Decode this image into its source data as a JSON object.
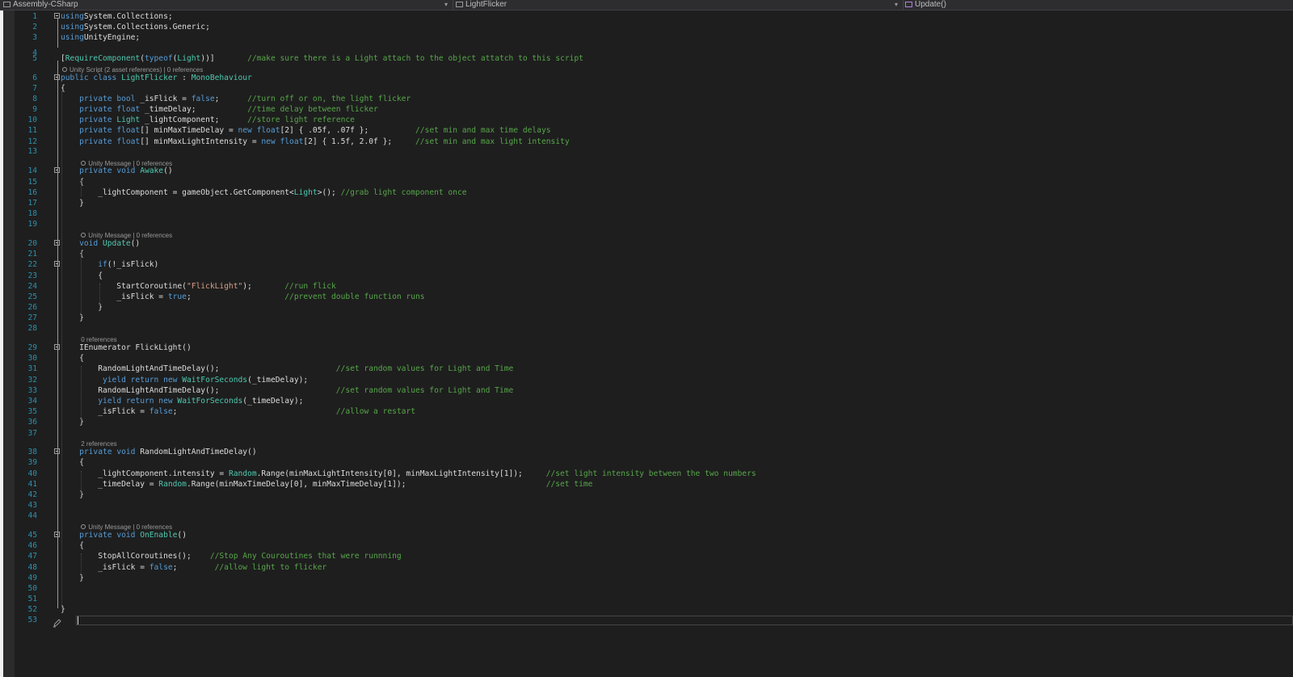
{
  "navbar": {
    "project": "Assembly-CSharp",
    "class": "LightFlicker",
    "member": "Update()"
  },
  "lenses": [
    {
      "line": 5,
      "indent": 0,
      "gear": true,
      "text": "Unity Script (2 asset references) | 0 references"
    },
    {
      "line": 13,
      "indent": 1,
      "gear": true,
      "text": "Unity Message | 0 references"
    },
    {
      "line": 19,
      "indent": 1,
      "gear": true,
      "text": "Unity Message | 0 references"
    },
    {
      "line": 28,
      "indent": 1,
      "gear": false,
      "text": "0 references"
    },
    {
      "line": 37,
      "indent": 1,
      "gear": false,
      "text": "2 references"
    },
    {
      "line": 44,
      "indent": 1,
      "gear": true,
      "text": "Unity Message | 0 references"
    }
  ],
  "lines": [
    {
      "n": 1,
      "fold": true,
      "tokens": [
        [
          "kw",
          "using"
        ],
        [
          "",
          "System.Collections;"
        ]
      ]
    },
    {
      "n": 2,
      "tokens": [
        [
          "kw",
          "using"
        ],
        [
          "",
          "System.Collections.Generic;"
        ]
      ]
    },
    {
      "n": 3,
      "tokens": [
        [
          "kw",
          "using"
        ],
        [
          "",
          "UnityEngine;"
        ]
      ]
    },
    {
      "n": 4,
      "tokens": []
    },
    {
      "n": 5,
      "tokens": [
        [
          "",
          "["
        ],
        [
          "ty",
          "RequireComponent"
        ],
        [
          "",
          "("
        ],
        [
          "kw",
          "typeof"
        ],
        [
          "",
          "("
        ],
        [
          "ty",
          "Light"
        ],
        [
          "",
          "))]       "
        ],
        [
          "cm",
          "//make sure there is a Light attach to the object attatch to this script"
        ]
      ]
    },
    {
      "n": 6,
      "fold": true,
      "tokens": [
        [
          "kw",
          "public class "
        ],
        [
          "ty",
          "LightFlicker"
        ],
        [
          "",
          " : "
        ],
        [
          "ty",
          "MonoBehaviour"
        ]
      ]
    },
    {
      "n": 7,
      "tokens": [
        [
          "",
          "{"
        ]
      ]
    },
    {
      "n": 8,
      "tokens": [
        [
          "",
          "    "
        ],
        [
          "kw",
          "private bool"
        ],
        [
          "",
          " _isFlick = "
        ],
        [
          "kw",
          "false"
        ],
        [
          "",
          ";      "
        ],
        [
          "cm",
          "//turn off or on, the light flicker"
        ]
      ]
    },
    {
      "n": 9,
      "tokens": [
        [
          "",
          "    "
        ],
        [
          "kw",
          "private float"
        ],
        [
          "",
          " _timeDelay;           "
        ],
        [
          "cm",
          "//time delay between flicker"
        ]
      ]
    },
    {
      "n": 10,
      "tokens": [
        [
          "",
          "    "
        ],
        [
          "kw",
          "private"
        ],
        [
          "",
          " "
        ],
        [
          "ty",
          "Light"
        ],
        [
          "",
          " _lightComponent;      "
        ],
        [
          "cm",
          "//store light reference"
        ]
      ]
    },
    {
      "n": 11,
      "tokens": [
        [
          "",
          "    "
        ],
        [
          "kw",
          "private float"
        ],
        [
          "",
          "[] minMaxTimeDelay = "
        ],
        [
          "kw",
          "new float"
        ],
        [
          "",
          "[2] { .05f, .07f };          "
        ],
        [
          "cm",
          "//set min and max time delays"
        ]
      ]
    },
    {
      "n": 12,
      "tokens": [
        [
          "",
          "    "
        ],
        [
          "kw",
          "private float"
        ],
        [
          "",
          "[] minMaxLightIntensity = "
        ],
        [
          "kw",
          "new float"
        ],
        [
          "",
          "[2] { 1.5f, 2.0f };     "
        ],
        [
          "cm",
          "//set min and max light intensity"
        ]
      ]
    },
    {
      "n": 13,
      "tokens": []
    },
    {
      "n": 14,
      "fold": true,
      "tokens": [
        [
          "",
          "    "
        ],
        [
          "kw",
          "private void"
        ],
        [
          "",
          " "
        ],
        [
          "ty",
          "Awake"
        ],
        [
          "",
          "()"
        ]
      ]
    },
    {
      "n": 15,
      "tokens": [
        [
          "",
          "    {"
        ]
      ]
    },
    {
      "n": 16,
      "tokens": [
        [
          "",
          "        _lightComponent = gameObject.GetComponent<"
        ],
        [
          "ty",
          "Light"
        ],
        [
          "",
          ">(); "
        ],
        [
          "cm",
          "//grab light component once"
        ]
      ]
    },
    {
      "n": 17,
      "tokens": [
        [
          "",
          "    }"
        ]
      ]
    },
    {
      "n": 18,
      "tokens": []
    },
    {
      "n": 19,
      "tokens": []
    },
    {
      "n": 20,
      "fold": true,
      "tokens": [
        [
          "",
          "    "
        ],
        [
          "kw",
          "void"
        ],
        [
          "",
          " "
        ],
        [
          "ty",
          "Update"
        ],
        [
          "",
          "()"
        ]
      ]
    },
    {
      "n": 21,
      "tokens": [
        [
          "",
          "    {"
        ]
      ]
    },
    {
      "n": 22,
      "fold": true,
      "tokens": [
        [
          "",
          "        "
        ],
        [
          "kw",
          "if"
        ],
        [
          "",
          "(!_isFlick)"
        ]
      ]
    },
    {
      "n": 23,
      "tokens": [
        [
          "",
          "        {"
        ]
      ]
    },
    {
      "n": 24,
      "tokens": [
        [
          "",
          "            StartCoroutine("
        ],
        [
          "str",
          "\"FlickLight\""
        ],
        [
          "",
          ");       "
        ],
        [
          "cm",
          "//run flick"
        ]
      ]
    },
    {
      "n": 25,
      "tokens": [
        [
          "",
          "            _isFlick = "
        ],
        [
          "kw",
          "true"
        ],
        [
          "",
          ";                    "
        ],
        [
          "cm",
          "//prevent double function runs"
        ]
      ]
    },
    {
      "n": 26,
      "tokens": [
        [
          "",
          "        }"
        ]
      ]
    },
    {
      "n": 27,
      "tokens": [
        [
          "",
          "    }"
        ]
      ]
    },
    {
      "n": 28,
      "tokens": []
    },
    {
      "n": 29,
      "fold": true,
      "tokens": [
        [
          "",
          "    IEnumerator FlickLight()"
        ]
      ]
    },
    {
      "n": 30,
      "tokens": [
        [
          "",
          "    {"
        ]
      ]
    },
    {
      "n": 31,
      "tokens": [
        [
          "",
          "        RandomLightAndTimeDelay();                         "
        ],
        [
          "cm",
          "//set random values for Light and Time"
        ]
      ]
    },
    {
      "n": 32,
      "tokens": [
        [
          "",
          "         "
        ],
        [
          "kw",
          "yield return new"
        ],
        [
          "",
          " "
        ],
        [
          "ty",
          "WaitForSeconds"
        ],
        [
          "",
          "(_timeDelay);"
        ]
      ]
    },
    {
      "n": 33,
      "tokens": [
        [
          "",
          "        RandomLightAndTimeDelay();                         "
        ],
        [
          "cm",
          "//set random values for Light and Time"
        ]
      ]
    },
    {
      "n": 34,
      "tokens": [
        [
          "",
          "        "
        ],
        [
          "kw",
          "yield return new"
        ],
        [
          "",
          " "
        ],
        [
          "ty",
          "WaitForSeconds"
        ],
        [
          "",
          "(_timeDelay);"
        ]
      ]
    },
    {
      "n": 35,
      "tokens": [
        [
          "",
          "        _isFlick = "
        ],
        [
          "kw",
          "false"
        ],
        [
          "",
          ";                                  "
        ],
        [
          "cm",
          "//allow a restart"
        ]
      ]
    },
    {
      "n": 36,
      "tokens": [
        [
          "",
          "    }"
        ]
      ]
    },
    {
      "n": 37,
      "tokens": []
    },
    {
      "n": 38,
      "fold": true,
      "tokens": [
        [
          "",
          "    "
        ],
        [
          "kw",
          "private void"
        ],
        [
          "",
          " RandomLightAndTimeDelay()"
        ]
      ]
    },
    {
      "n": 39,
      "tokens": [
        [
          "",
          "    {"
        ]
      ]
    },
    {
      "n": 40,
      "tokens": [
        [
          "",
          "        _lightComponent.intensity = "
        ],
        [
          "ty",
          "Random"
        ],
        [
          "",
          ".Range(minMaxLightIntensity[0], minMaxLightIntensity[1]);     "
        ],
        [
          "cm",
          "//set light intensity between the two numbers"
        ]
      ]
    },
    {
      "n": 41,
      "tokens": [
        [
          "",
          "        _timeDelay = "
        ],
        [
          "ty",
          "Random"
        ],
        [
          "",
          ".Range(minMaxTimeDelay[0], minMaxTimeDelay[1]);                              "
        ],
        [
          "cm",
          "//set time"
        ]
      ]
    },
    {
      "n": 42,
      "tokens": [
        [
          "",
          "    }"
        ]
      ]
    },
    {
      "n": 43,
      "tokens": []
    },
    {
      "n": 44,
      "tokens": []
    },
    {
      "n": 45,
      "fold": true,
      "tokens": [
        [
          "",
          "    "
        ],
        [
          "kw",
          "private void"
        ],
        [
          "",
          " "
        ],
        [
          "ty",
          "OnEnable"
        ],
        [
          "",
          "()"
        ]
      ]
    },
    {
      "n": 46,
      "tokens": [
        [
          "",
          "    {"
        ]
      ]
    },
    {
      "n": 47,
      "tokens": [
        [
          "",
          "        StopAllCoroutines();    "
        ],
        [
          "cm",
          "//Stop Any Couroutines that were runnning"
        ]
      ]
    },
    {
      "n": 48,
      "tokens": [
        [
          "",
          "        _isFlick = "
        ],
        [
          "kw",
          "false"
        ],
        [
          "",
          ";        "
        ],
        [
          "cm",
          "//allow light to flicker"
        ]
      ]
    },
    {
      "n": 49,
      "tokens": [
        [
          "",
          "    }"
        ]
      ]
    },
    {
      "n": 50,
      "tokens": []
    },
    {
      "n": 51,
      "tokens": []
    },
    {
      "n": 52,
      "tokens": [
        [
          "",
          "}"
        ]
      ]
    },
    {
      "n": 53,
      "tokens": []
    }
  ],
  "cursor_line": 53,
  "icons": {
    "pencil": "pencil-icon",
    "lens_gear": "gear-icon",
    "fold_toggle": "collapse-icon"
  }
}
